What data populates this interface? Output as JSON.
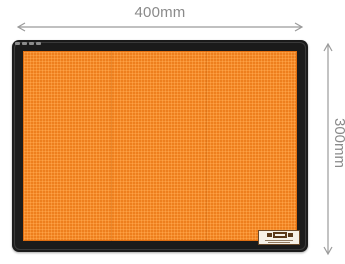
{
  "dimensions": {
    "width_label": "400mm",
    "height_label": "300mm"
  },
  "colors": {
    "plate_face": "#f7841f",
    "frame": "#1b1b1b",
    "dimension_text": "#8a8a8a",
    "dimension_arrow": "#9b9b9b"
  },
  "icons": {
    "width_arrow": "double-headed-horizontal-arrow",
    "height_arrow": "double-headed-vertical-arrow",
    "maker_logo": "manufacturer-logo"
  }
}
